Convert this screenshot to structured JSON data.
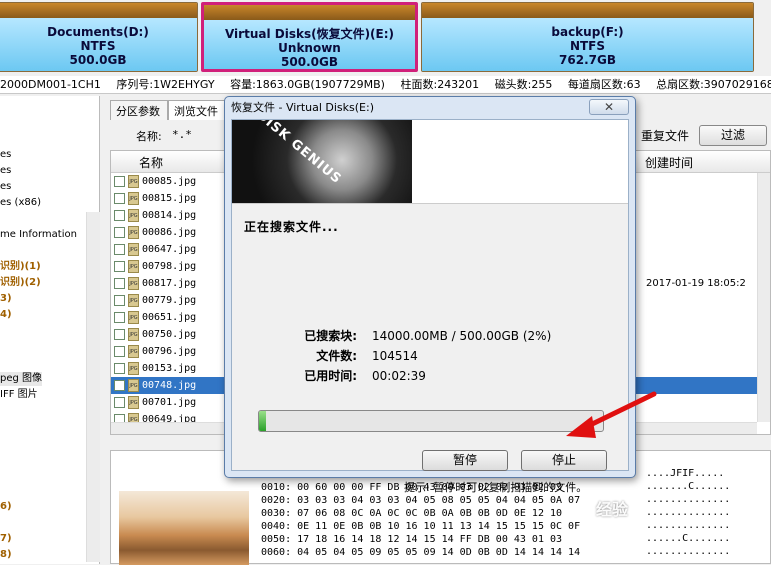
{
  "disks": [
    {
      "name": "Documents(D:)",
      "fs": "NTFS",
      "size": "500.0GB"
    },
    {
      "name": "Virtual Disks(恢复文件)(E:)",
      "fs": "Unknown",
      "size": "500.0GB"
    },
    {
      "name": "backup(F:)",
      "fs": "NTFS",
      "size": "762.7GB"
    }
  ],
  "info": {
    "model": "2000DM001-1CH1",
    "serial": "序列号:1W2EHYGY",
    "capacity": "容量:1863.0GB(1907729MB)",
    "cylinders": "柱面数:243201",
    "heads": "磁头数:255",
    "sectors_per_track": "每道扇区数:63",
    "total_sectors": "总扇区数:3907029168"
  },
  "tree": [
    "es",
    "es",
    "es",
    "es (x86)",
    "me Information",
    "识别)(1)",
    "识别)(2)",
    "3)",
    "4)",
    "peg 图像",
    "IFF 图片",
    "6)",
    "7)",
    "8)"
  ],
  "tabs": {
    "partition": "分区参数",
    "browse": "浏览文件"
  },
  "filter": {
    "name_label": "名称:",
    "name_value": "*.*",
    "recovered_label": "重复文件",
    "filter_button": "过滤"
  },
  "list": {
    "col_name": "名称",
    "col_created": "创建时间",
    "files": [
      "00085.jpg",
      "00815.jpg",
      "00814.jpg",
      "00086.jpg",
      "00647.jpg",
      "00798.jpg",
      "00817.jpg",
      "00779.jpg",
      "00651.jpg",
      "00750.jpg",
      "00796.jpg",
      "00153.jpg",
      "00748.jpg",
      "00701.jpg",
      "00649.jpg"
    ],
    "selected_index": 12,
    "timestamp": "2017-01-19 18:05:2"
  },
  "hex": {
    "lines": [
      "0010: 00 60 00 00 FF DB 00 43 00 03 02 02 03 02 03",
      "0020: 03 03 03 04 03 03 04 05 08 05 05 04 04 05 0A 07",
      "0030: 07 06 08 0C 0A 0C 0C 0B 0A 0B 0B 0D 0E 12 10",
      "0040: 0E 11 0E 0B 0B 10 16 10 11 13 14 15 15 15 0C 0F",
      "0050: 17 18 16 14 18 12 14 15 14 FF DB 00 43 01 03",
      "0060: 04 05 04 05 09 05 05 09 14 0D 0B 0D 14 14 14 14"
    ],
    "ascii": [
      "....JFIF.....",
      ".......C......",
      "..............",
      "..............",
      "..............",
      "......C.......",
      ".............."
    ]
  },
  "dialog": {
    "title": "恢复文件 - Virtual Disks(E:)",
    "close": "✕",
    "brand": "DISK GENIUS",
    "status": "正在搜索文件...",
    "searched_label": "已搜索块:",
    "searched_value": "14000.00MB / 500.00GB (2%)",
    "files_label": "文件数:",
    "files_value": "104514",
    "elapsed_label": "已用时间:",
    "elapsed_value": "00:02:39",
    "progress": 0.02,
    "pause": "暂停",
    "stop": "停止",
    "hint": "提示: 暂停时可以复制扫描到的文件。"
  },
  "watermark": "经验"
}
